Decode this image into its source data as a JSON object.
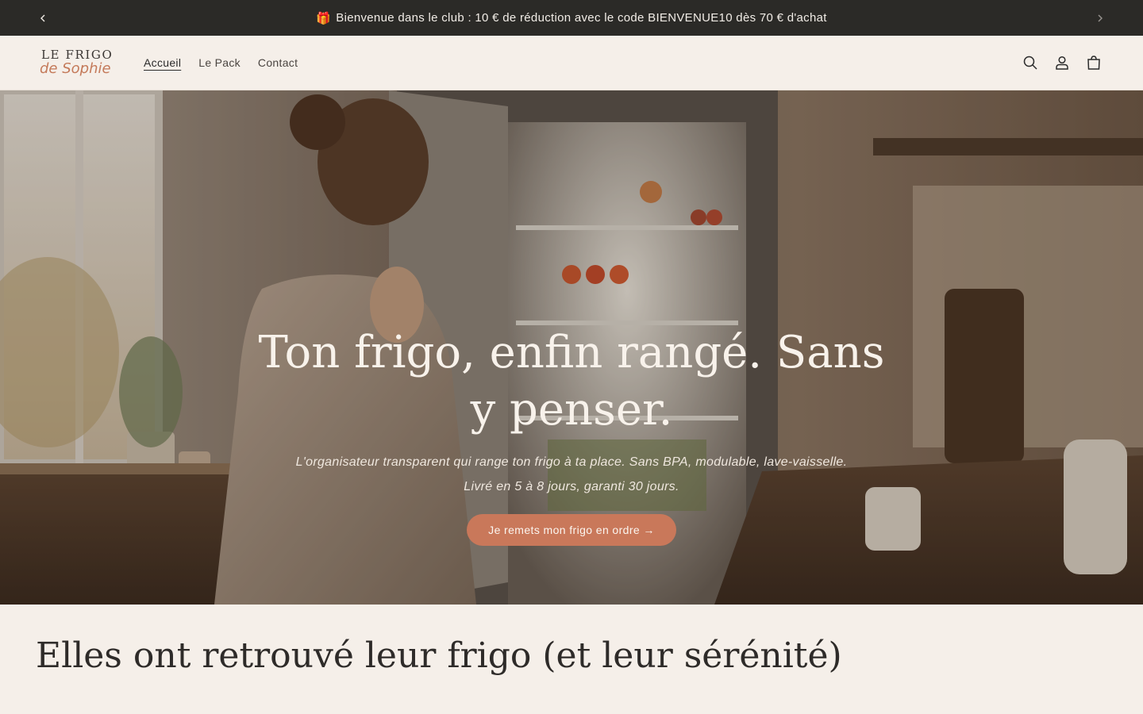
{
  "announcement": {
    "gift_icon": "🎁",
    "text": "Bienvenue dans le club : 10 € de réduction avec le code BIENVENUE10 dès 70 € d'achat"
  },
  "header": {
    "logo_line1": "LE FRIGO",
    "logo_line2": "de Sophie",
    "nav": [
      {
        "label": "Accueil"
      },
      {
        "label": "Le Pack"
      },
      {
        "label": "Contact"
      }
    ],
    "icons": [
      "search-icon",
      "account-icon",
      "cart-icon"
    ]
  },
  "hero": {
    "title": "Ton frigo, enfin rangé. Sans y penser.",
    "subtitle_line1": "L'organisateur transparent qui range ton frigo à ta place. Sans BPA, modulable, lave-vaisselle.",
    "subtitle_line2": "Livré en 5 à 8 jours, garanti 30 jours.",
    "cta": "Je remets mon frigo en ordre →"
  },
  "testimonials": {
    "title": "Elles ont retrouvé leur frigo (et leur sérénité)"
  },
  "colors": {
    "background": "#f5efe9",
    "announcement_bg": "#2b2a27",
    "accent": "#c9785a",
    "logo_accent": "#c47a5a"
  }
}
